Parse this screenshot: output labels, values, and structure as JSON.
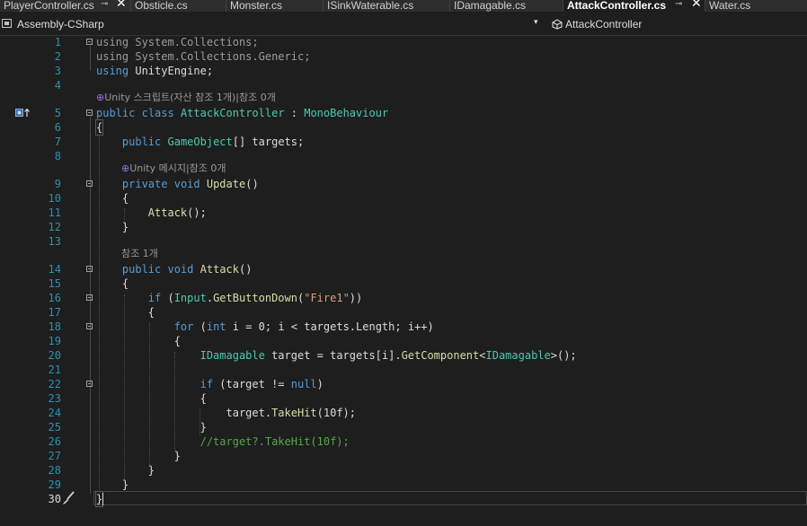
{
  "tabs": [
    {
      "label": "PlayerController.cs",
      "pin": "⊸",
      "close": "✕"
    },
    {
      "label": "Obsticle.cs"
    },
    {
      "label": "Monster.cs"
    },
    {
      "label": "ISinkWaterable.cs"
    },
    {
      "label": "IDamagable.cs"
    },
    {
      "label": "AttackController.cs",
      "pin": "⊸",
      "close": "✕"
    },
    {
      "label": "Water.cs"
    }
  ],
  "navbar": {
    "project": "Assembly-CSharp",
    "dropdown_arrow": "▾",
    "class_name": "AttackController"
  },
  "colors": {
    "keyword": "#569cd6",
    "type": "#4ec9b0",
    "method": "#dcdcaa",
    "string": "#d69d85",
    "comment": "#57a64a",
    "line_number": "#2b91af",
    "background": "#1e1e1e"
  },
  "gutter": {
    "line5_icon": "implementation-arrow-icon",
    "line30_icon": "quick-action-brush-icon"
  },
  "lens": {
    "unity_script": "Unity 스크립트(자산 참조 1개)|참조 0개",
    "unity_message": "Unity 메시지|참조 0개",
    "refs_one": "참조 1개"
  },
  "code": {
    "l1": [
      "using",
      " System.Collections;"
    ],
    "l2": [
      "using",
      " System.Collections.Generic;"
    ],
    "l3": [
      "using",
      " UnityEngine;"
    ],
    "l5": [
      "public",
      " ",
      "class",
      " ",
      "AttackController",
      " : ",
      "MonoBehaviour"
    ],
    "l6": "{",
    "l7": [
      "    ",
      "public",
      " ",
      "GameObject",
      "[] targets;"
    ],
    "l9": [
      "    ",
      "private",
      " ",
      "void",
      " ",
      "Update",
      "()"
    ],
    "l10": "    {",
    "l11": [
      "        ",
      "Attack",
      "();"
    ],
    "l12": "    }",
    "l14": [
      "    ",
      "public",
      " ",
      "void",
      " ",
      "Attack",
      "()"
    ],
    "l15": "    {",
    "l16": [
      "        ",
      "if",
      " (",
      "Input",
      ".",
      "GetButtonDown",
      "(",
      "\"Fire1\"",
      "))"
    ],
    "l17": "        {",
    "l18": [
      "            ",
      "for",
      " (",
      "int",
      " i = 0; i < targets.Length; i++)"
    ],
    "l19": "            {",
    "l20": [
      "                ",
      "IDamagable",
      " target = targets[i].",
      "GetComponent",
      "<",
      "IDamagable",
      ">();"
    ],
    "l22": [
      "                ",
      "if",
      " (target != ",
      "null",
      ")"
    ],
    "l23": "                {",
    "l24": [
      "                    target.",
      "TakeHit",
      "(10f);"
    ],
    "l25": "                }",
    "l26": [
      "                ",
      "//target?.TakeHit(10f);"
    ],
    "l27": "            }",
    "l28": "        }",
    "l29": "    }",
    "l30": "}"
  }
}
